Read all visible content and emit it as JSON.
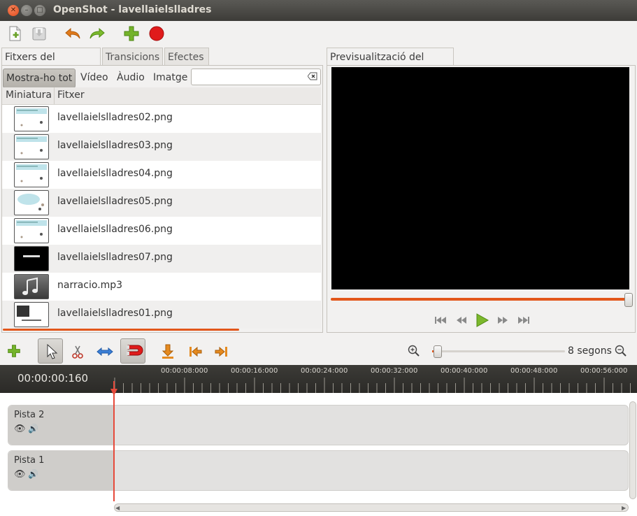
{
  "window": {
    "title": "OpenShot - lavellaielslladres"
  },
  "toolbar": {
    "icons": [
      "new-project-icon",
      "save-project-icon",
      "undo-icon",
      "redo-icon",
      "import-files-icon",
      "record-icon"
    ]
  },
  "left_tabs": [
    "Fitxers del projecte",
    "Transicions",
    "Efectes"
  ],
  "filters": [
    "Mostra-ho tot",
    "Vídeo",
    "Àudio",
    "Imatge"
  ],
  "search": {
    "value": ""
  },
  "columns": [
    "Miniatura",
    "Fitxer"
  ],
  "files": [
    {
      "name": "lavellaielslladres02.png",
      "thumb": "slide"
    },
    {
      "name": "lavellaielslladres03.png",
      "thumb": "slide"
    },
    {
      "name": "lavellaielslladres04.png",
      "thumb": "slide"
    },
    {
      "name": "lavellaielslladres05.png",
      "thumb": "bubble"
    },
    {
      "name": "lavellaielslladres06.png",
      "thumb": "slide"
    },
    {
      "name": "lavellaielslladres07.png",
      "thumb": "dark"
    },
    {
      "name": "narracio.mp3",
      "thumb": "music"
    },
    {
      "name": "lavellaielslladres01.png",
      "thumb": "cover"
    }
  ],
  "preview": {
    "tab": "Previsualització del vídeo"
  },
  "timeline": {
    "zoom_label": "8 segons",
    "timecode": "00:00:00:160",
    "ruler_labels": [
      "00:00:08:000",
      "00:00:16:000",
      "00:00:24:000",
      "00:00:32:000",
      "00:00:40:000",
      "00:00:48:000",
      "00:00:56:000"
    ],
    "tracks": [
      {
        "name": "Pista 2"
      },
      {
        "name": "Pista 1"
      }
    ]
  },
  "colors": {
    "accent": "#e2561a",
    "titlebar": "#3d3c38",
    "ruler": "#2f2e2b"
  }
}
